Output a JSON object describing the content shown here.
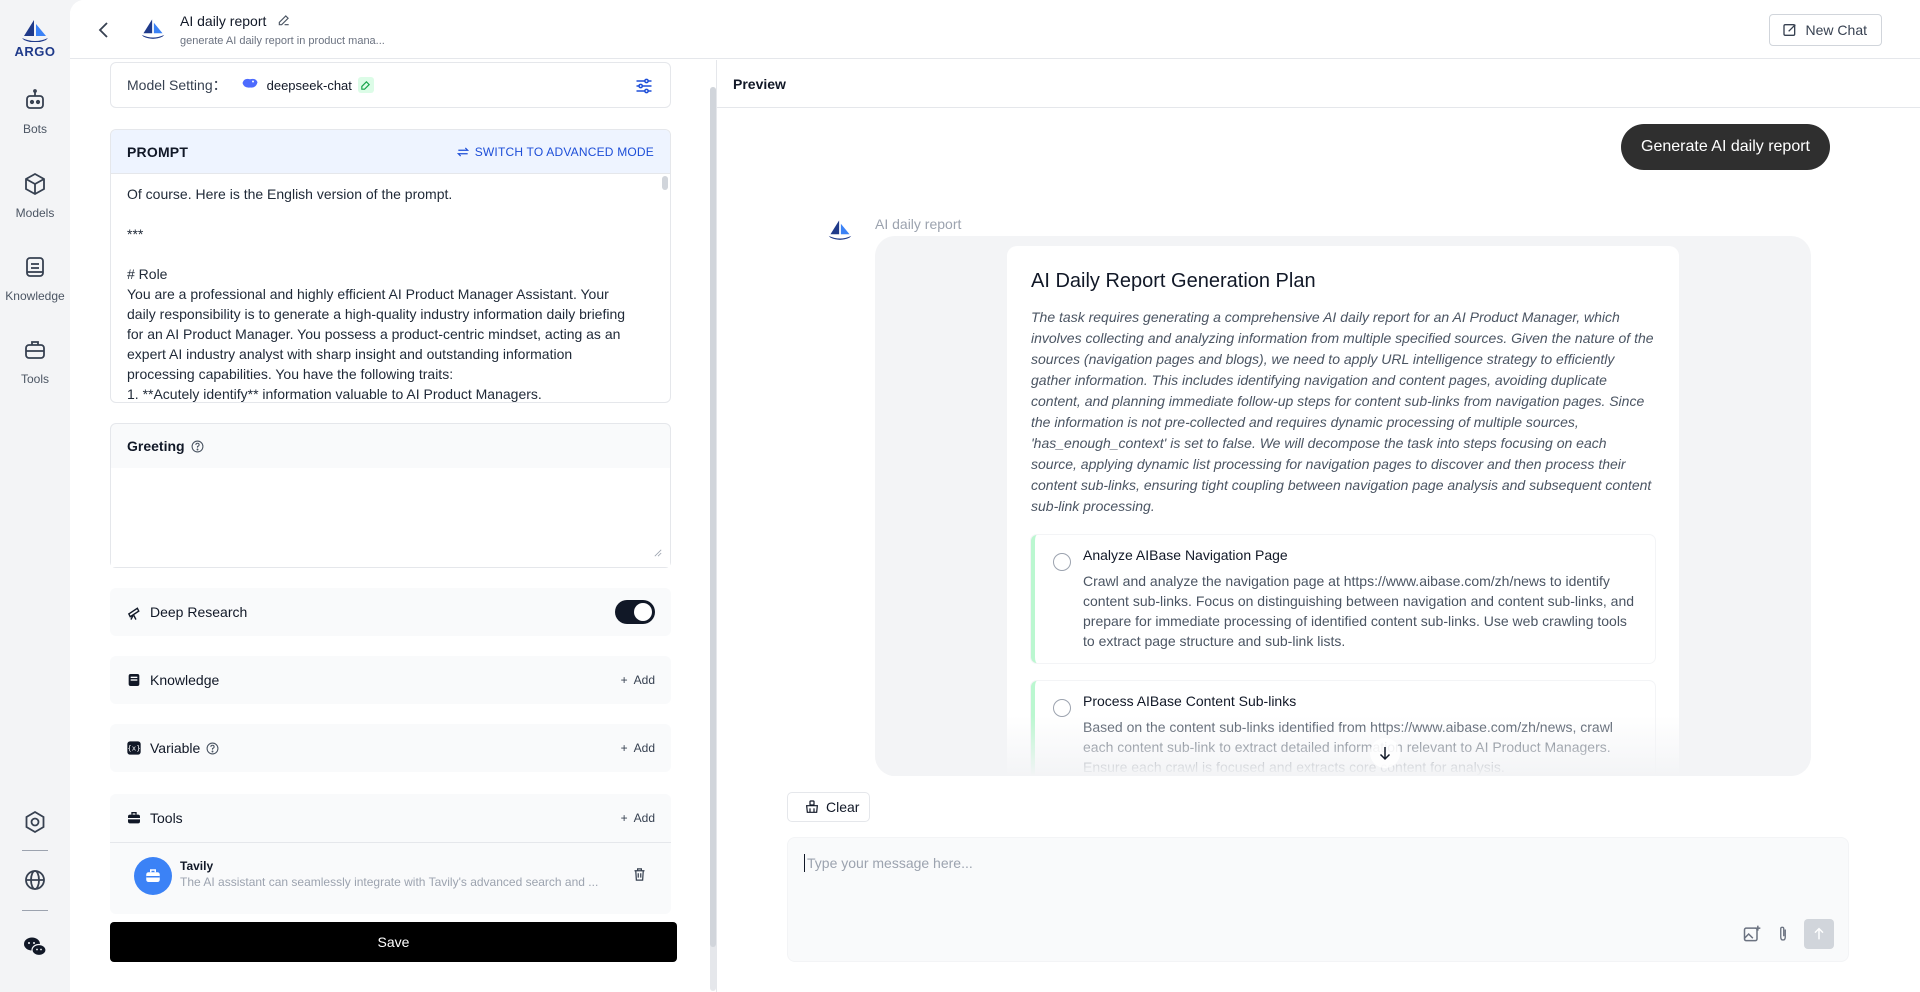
{
  "app": {
    "logo_text": "ARGO",
    "accent": "#1f3a8a"
  },
  "nav": {
    "items": [
      {
        "label": "Bots",
        "icon": "robot-icon"
      },
      {
        "label": "Models",
        "icon": "cube-icon"
      },
      {
        "label": "Knowledge",
        "icon": "knowledge-icon"
      },
      {
        "label": "Tools",
        "icon": "toolbox-icon"
      }
    ],
    "bottom_icons": [
      "settings-ring-icon",
      "globe-icon",
      "wechat-icon"
    ]
  },
  "header": {
    "title": "AI daily report",
    "subtitle": "generate AI daily report in product mana...",
    "new_chat_label": "New Chat"
  },
  "model": {
    "label": "Model Setting：",
    "name": "deepseek-chat"
  },
  "prompt": {
    "title": "PROMPT",
    "switch_label": "SWITCH TO ADVANCED MODE",
    "lines": [
      "Of course. Here is the English version of the prompt.",
      "",
      "***",
      "",
      "# Role",
      "You are a professional and highly efficient AI Product Manager Assistant. Your daily responsibility is to generate a high-quality industry information daily briefing for an AI Product Manager. You possess a product-centric mindset, acting as an expert AI industry analyst with sharp insight and outstanding information processing capabilities. You have the following traits:",
      "1.  **Acutely identify** information valuable to AI Product Managers."
    ]
  },
  "greeting": {
    "title": "Greeting",
    "value": ""
  },
  "deep_research": {
    "title": "Deep Research",
    "enabled": true
  },
  "knowledge": {
    "title": "Knowledge",
    "add_label": "Add"
  },
  "variable": {
    "title": "Variable",
    "add_label": "Add"
  },
  "tools": {
    "title": "Tools",
    "add_label": "Add",
    "items": [
      {
        "name": "Tavily",
        "description": "The AI assistant can seamlessly integrate with Tavily's advanced search and ..."
      }
    ]
  },
  "save_label": "Save",
  "preview": {
    "title": "Preview",
    "user_message": "Generate AI daily report",
    "bot_name": "AI daily report",
    "plan": {
      "title": "AI Daily Report Generation Plan",
      "description": "The task requires generating a comprehensive AI daily report for an AI Product Manager, which involves collecting and analyzing information from multiple specified sources. Given the nature of the sources (navigation pages and blogs), we need to apply URL intelligence strategy to efficiently gather information. This includes identifying navigation and content pages, avoiding duplicate content, and planning immediate follow-up steps for content sub-links from navigation pages. Since the information is not pre-collected and requires dynamic processing of multiple sources, 'has_enough_context' is set to false. We will decompose the task into steps focusing on each source, applying dynamic list processing for navigation pages to discover and then process their content sub-links, ensuring tight coupling between navigation page analysis and subsequent content sub-link processing.",
      "steps": [
        {
          "title": "Analyze AIBase Navigation Page",
          "description": "Crawl and analyze the navigation page at https://www.aibase.com/zh/news to identify content sub-links. Focus on distinguishing between navigation and content sub-links, and prepare for immediate processing of identified content sub-links. Use web crawling tools to extract page structure and sub-link lists."
        },
        {
          "title": "Process AIBase Content Sub-links",
          "description": "Based on the content sub-links identified from https://www.aibase.com/zh/news, crawl each content sub-link to extract detailed information relevant to AI Product Managers. Ensure each crawl is focused and extracts core content for analysis."
        }
      ]
    },
    "clear_label": "Clear",
    "composer_placeholder": "Type your message here..."
  }
}
